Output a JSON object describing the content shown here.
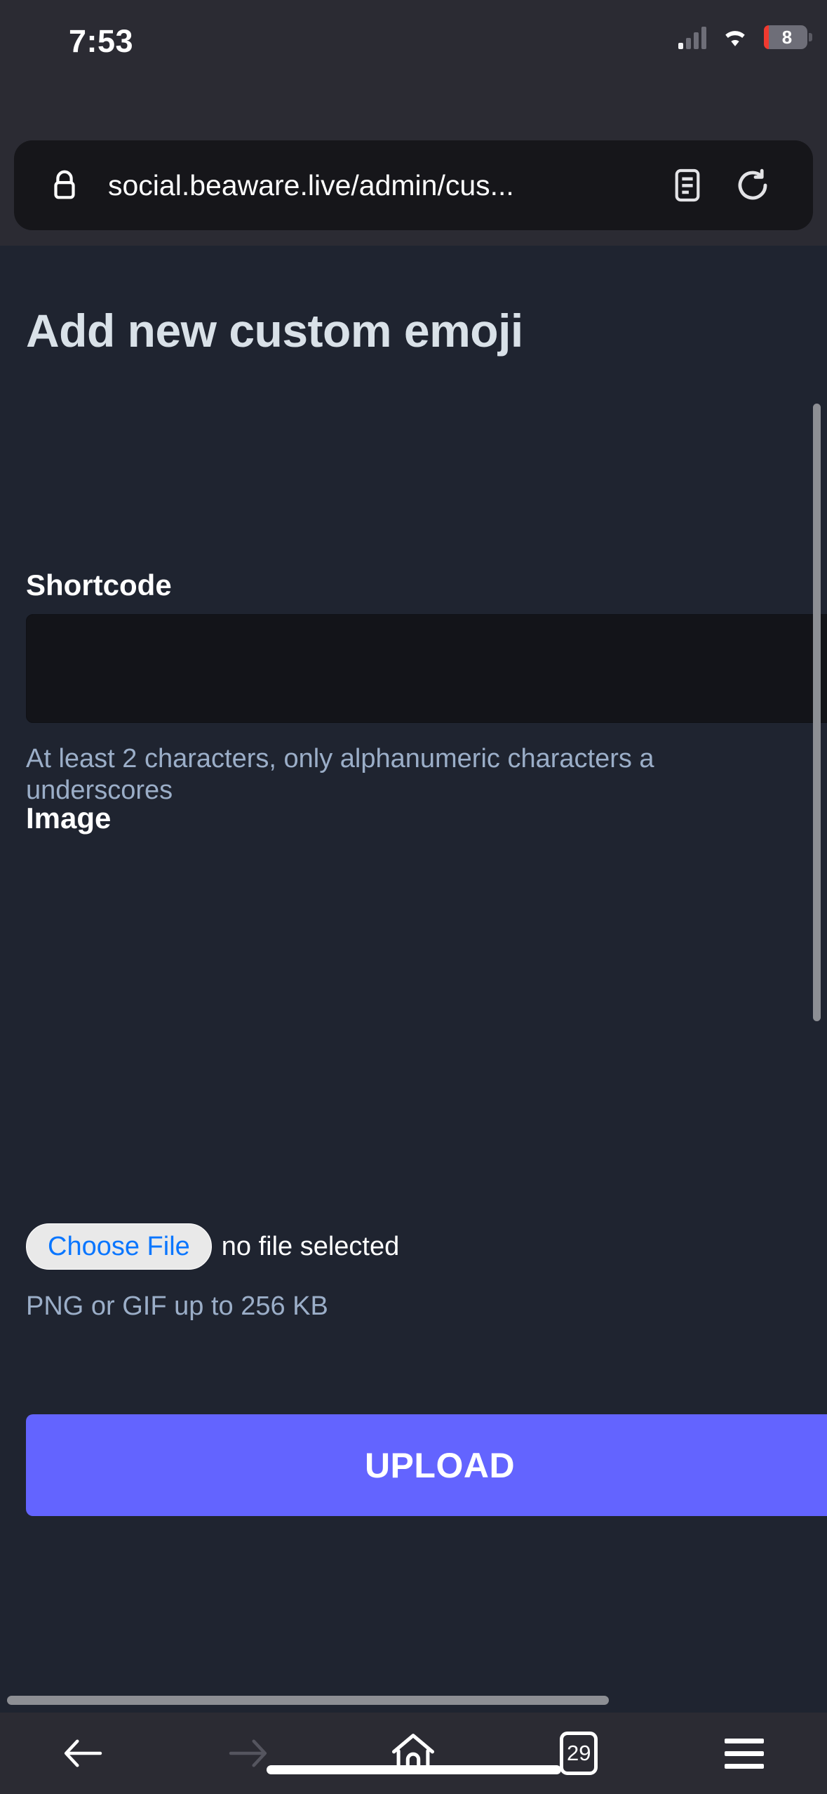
{
  "status_bar": {
    "time": "7:53",
    "battery_level": "8",
    "signal_icon": "cellular-signal-icon",
    "wifi_icon": "wifi-icon",
    "battery_icon": "battery-icon"
  },
  "browser": {
    "url": "social.beaware.live/admin/cus...",
    "lock_icon": "lock-icon",
    "reader_icon": "reader-mode-icon",
    "reload_icon": "reload-icon",
    "toolbar": {
      "back_icon": "back-arrow-icon",
      "forward_icon": "forward-arrow-icon",
      "home_icon": "home-icon",
      "tab_count": "29",
      "menu_icon": "hamburger-menu-icon"
    }
  },
  "page": {
    "title": "Add new custom emoji",
    "fields": {
      "shortcode": {
        "label": "Shortcode",
        "value": "",
        "hint_line1": "At least 2 characters, only alphanumeric characters a",
        "hint_line2": "underscores"
      },
      "image": {
        "label": "Image",
        "choose_file_label": "Choose File",
        "file_status": "no file selected",
        "hint": "PNG or GIF up to 256 KB"
      }
    },
    "submit_label": "UPLOAD"
  },
  "colors": {
    "accent": "#6364ff",
    "page_bg": "#1f2430",
    "chrome_bg": "#2b2b33",
    "muted_text": "#9baec8",
    "link_blue": "#0a76ff",
    "battery_red": "#f03a2f"
  }
}
